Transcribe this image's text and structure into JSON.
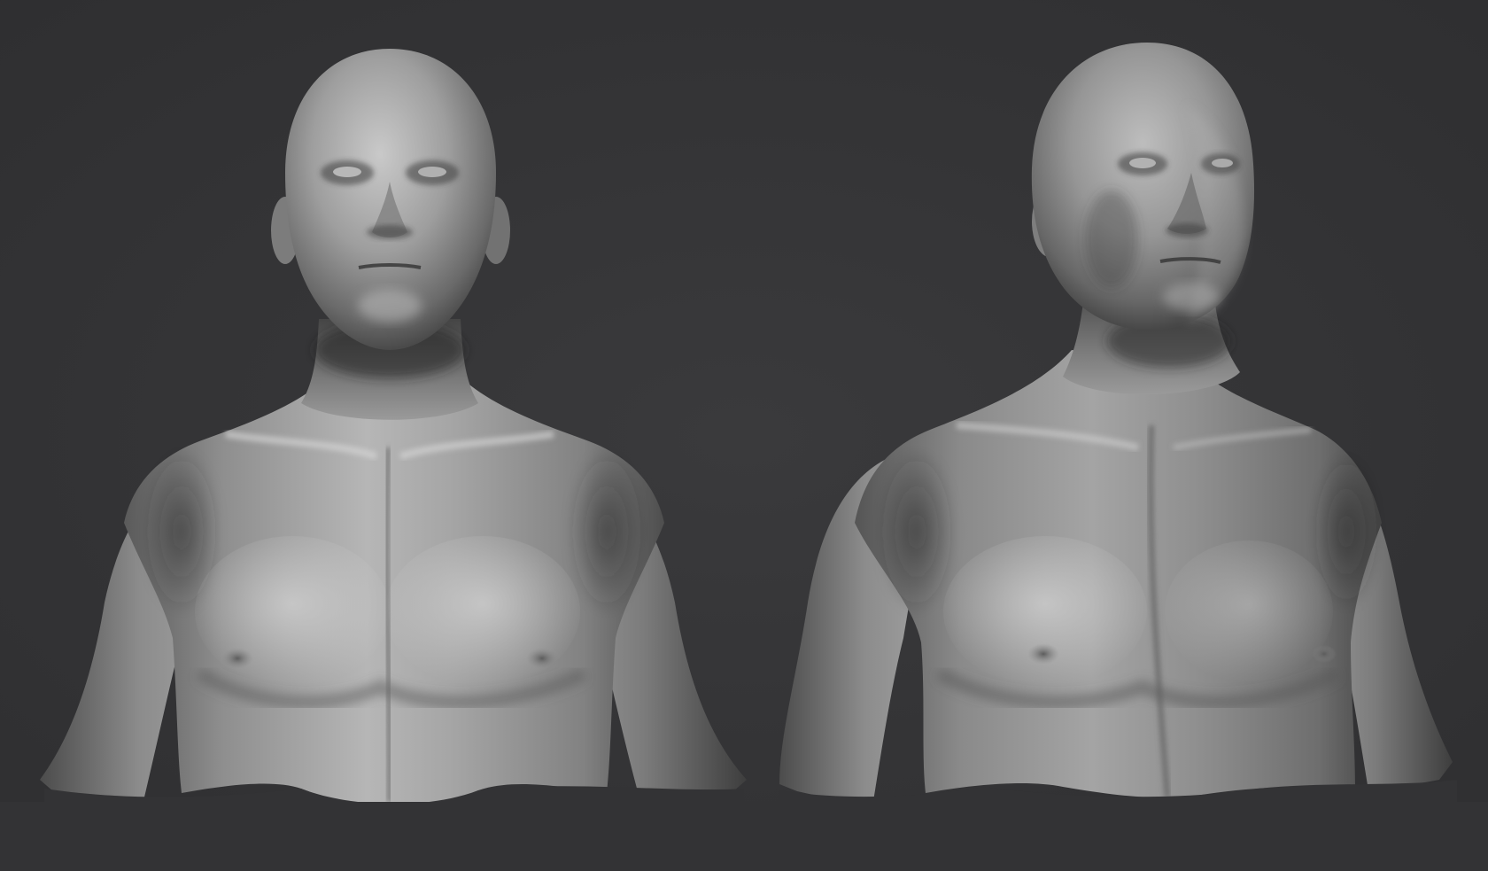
{
  "scene": {
    "background_color": "#333335",
    "material_highlight": "#ececec",
    "material_mid": "#8c8c8c",
    "material_shadow": "#2a2a2a",
    "subjects": [
      {
        "name": "bust-front-view",
        "view": "front"
      },
      {
        "name": "bust-three-quarter-view",
        "view": "three-quarter"
      }
    ]
  }
}
